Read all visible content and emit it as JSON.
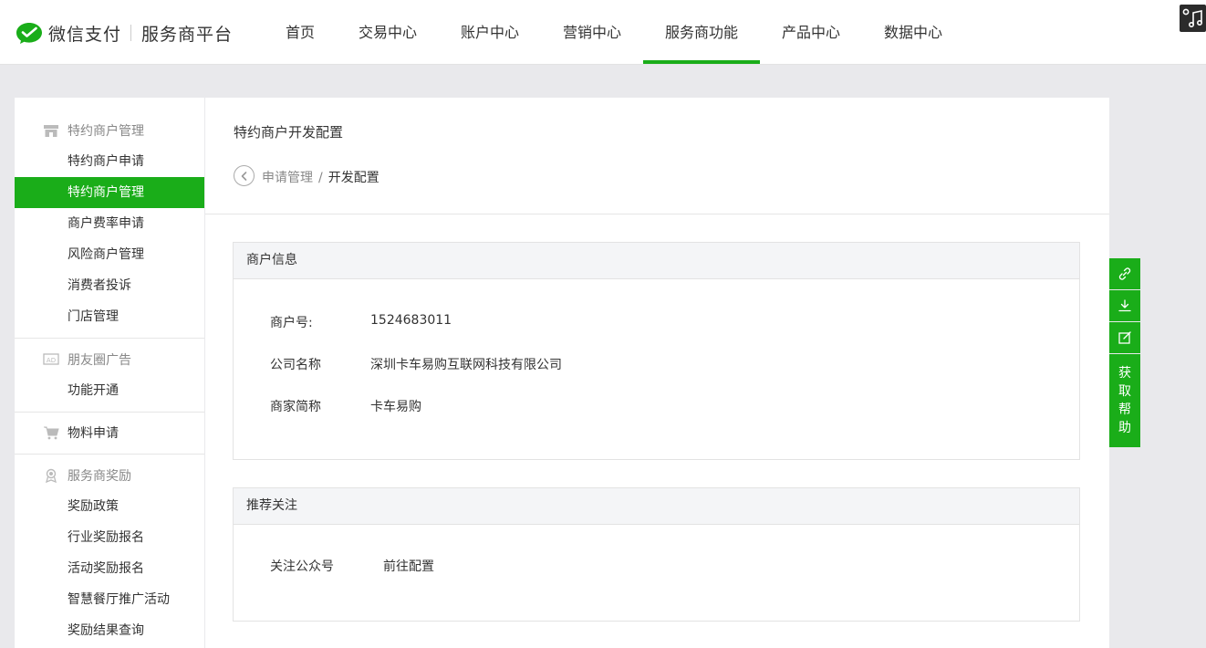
{
  "header": {
    "brand": "微信支付",
    "subtitle": "服务商平台",
    "nav": [
      {
        "label": "首页"
      },
      {
        "label": "交易中心"
      },
      {
        "label": "账户中心"
      },
      {
        "label": "营销中心"
      },
      {
        "label": "服务商功能",
        "active": true
      },
      {
        "label": "产品中心"
      },
      {
        "label": "数据中心"
      }
    ],
    "accent_color": "#1aad19",
    "corner_icon": "music-note-icon"
  },
  "sidebar": {
    "groups": [
      {
        "title": "特约商户管理",
        "icon": "store-icon",
        "items": [
          "特约商户申请",
          "特约商户管理",
          "商户费率申请",
          "风险商户管理",
          "消费者投诉",
          "门店管理"
        ],
        "active_item": "特约商户管理"
      },
      {
        "title": "朋友圈广告",
        "icon": "ad-icon",
        "items": [
          "功能开通"
        ]
      },
      {
        "title": "物料申请",
        "icon": "cart-icon",
        "items": []
      },
      {
        "title": "服务商奖励",
        "icon": "award-icon",
        "items": [
          "奖励政策",
          "行业奖励报名",
          "活动奖励报名",
          "智慧餐厅推广活动",
          "奖励结果查询"
        ]
      }
    ]
  },
  "main": {
    "title": "特约商户开发配置",
    "breadcrumb": {
      "parent": "申请管理",
      "separator": "/",
      "current": "开发配置"
    },
    "merchant_info": {
      "heading": "商户信息",
      "merchant_id_label": "商户号:",
      "merchant_id": "1524683011",
      "company_label": "公司名称",
      "company": "深圳卡车易购互联网科技有限公司",
      "short_name_label": "商家简称",
      "short_name": "卡车易购"
    },
    "recommend": {
      "heading": "推荐关注",
      "follow_label": "关注公众号",
      "follow_link": "前往配置"
    }
  },
  "tools": {
    "link_icon": "link-icon",
    "download_icon": "download-icon",
    "edit_icon": "edit-icon",
    "help_label": "获取帮助"
  }
}
